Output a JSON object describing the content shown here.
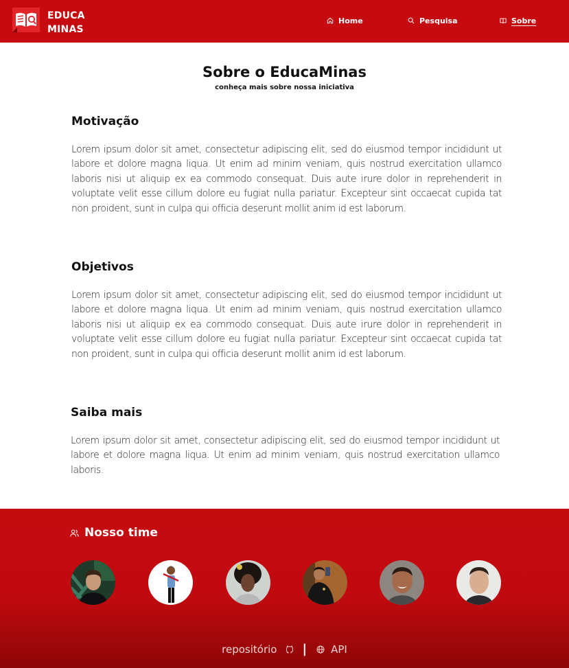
{
  "header": {
    "logo_line1": "EDUCA",
    "logo_line2": "MINAS",
    "nav": [
      {
        "label": "Home",
        "icon": "home-icon"
      },
      {
        "label": "Pesquisa",
        "icon": "search-icon"
      },
      {
        "label": "Sobre",
        "icon": "book-icon",
        "active": true
      }
    ]
  },
  "main": {
    "title": "Sobre o EducaMinas",
    "subtitle": "conheça mais sobre nossa iniciativa",
    "sections": [
      {
        "heading": "Motivação",
        "text": "Lorem ipsum dolor sit amet, consectetur adipiscing elit, sed do eiusmod tempor incididunt ut labore et dolore magna liqua. Ut enim ad minim veniam, quis nostrud exercitation ullamco laboris nisi ut aliquip ex ea commodo consequat. Duis aute irure dolor in reprehenderit in voluptate velit esse cillum dolore eu fugiat nulla pariatur. Excepteur sint occaecat cupida tat non proident, sunt in culpa qui officia deserunt mollit anim id est laborum."
      },
      {
        "heading": "Objetivos",
        "text": "Lorem ipsum dolor sit amet, consectetur adipiscing elit, sed do eiusmod tempor incididunt ut labore et dolore magna liqua. Ut enim ad minim veniam, quis nostrud exercitation ullamco laboris nisi ut aliquip ex ea commodo consequat. Duis aute irure dolor in reprehenderit in voluptate velit esse cillum dolore eu fugiat nulla pariatur. Excepteur sint occaecat cupida tat non proident, sunt in culpa qui officia deserunt mollit anim id est laborum."
      },
      {
        "heading": "Saiba mais",
        "text": "Lorem ipsum dolor sit amet, consectetur adipiscing elit, sed do eiusmod tempor incididunt ut labore et dolore magna liqua. Ut enim ad minim veniam, quis nostrud exercitation ullamco laboris."
      }
    ]
  },
  "footer": {
    "team_title": "Nosso time",
    "team_icon": "users-icon",
    "repo_label": "repositório",
    "repo_icon": "github-icon",
    "separator": "|",
    "api_label": "API",
    "api_icon": "globe-icon"
  },
  "colors": {
    "brand_red": "#c50b10",
    "footer_dark": "#8e0607",
    "text": "#111111"
  }
}
